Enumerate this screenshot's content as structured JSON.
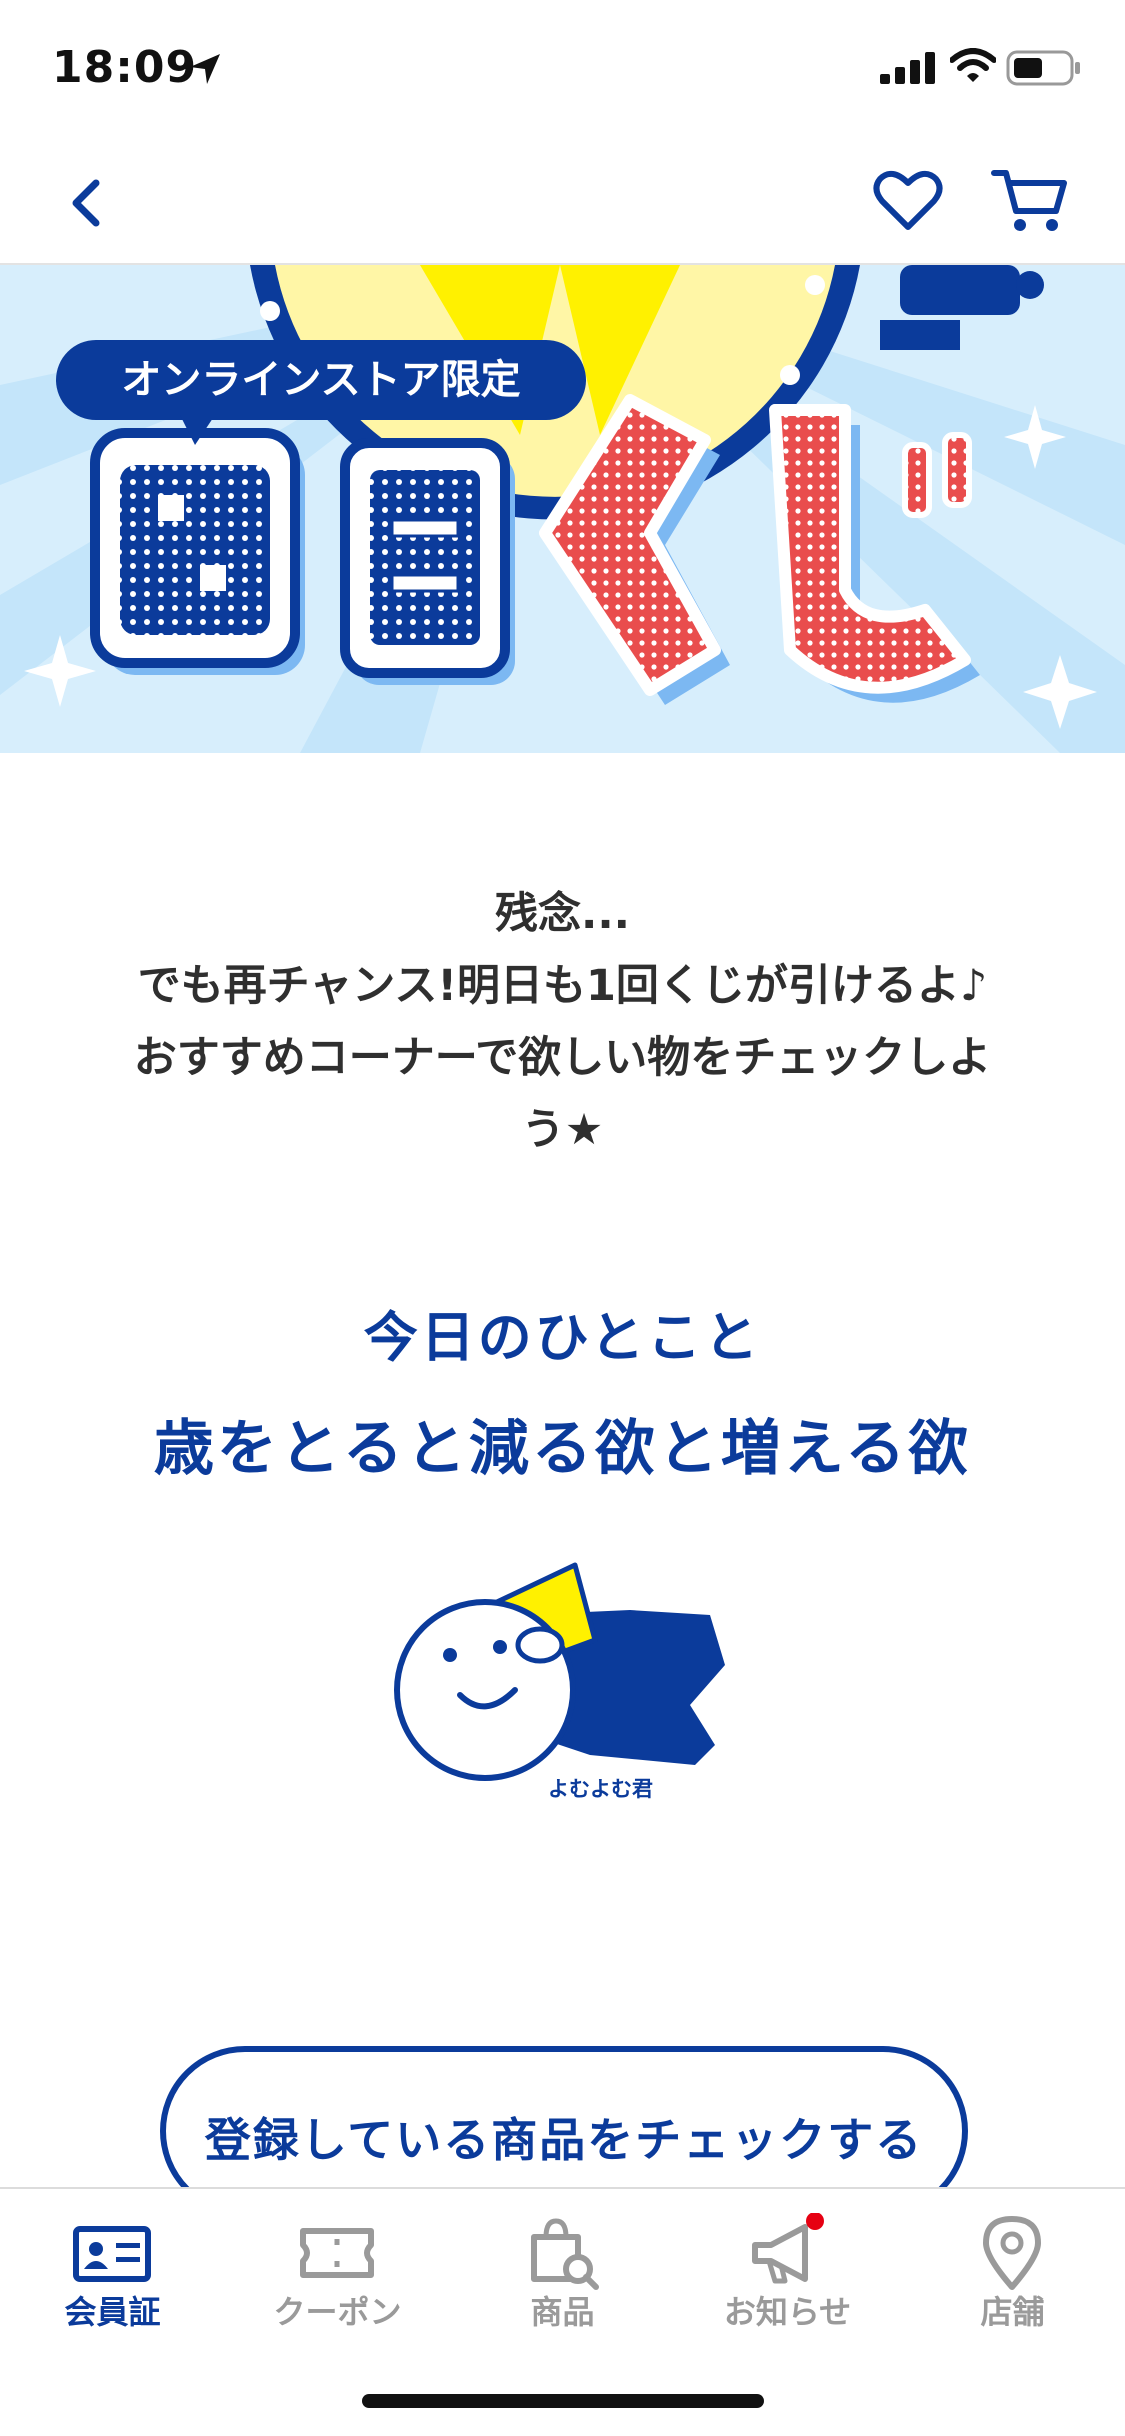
{
  "status_bar": {
    "time": "18:09"
  },
  "banner": {
    "badge": "オンラインストア限定",
    "title": "毎日くじ"
  },
  "message": {
    "line1": "残念...",
    "line2": "でも再チャンス!明日も1回くじが引けるよ♪",
    "line3": "おすすめコーナーで欲しい物をチェックしよ",
    "line4": "う★"
  },
  "today": {
    "heading": "今日のひとこと",
    "phrase": "歳をとると減る欲と増える欲"
  },
  "mascot": {
    "name": "よむよむ君"
  },
  "check_button": {
    "label": "登録している商品をチェックする"
  },
  "tabs": [
    {
      "label": "会員証",
      "icon": "member-card-icon",
      "active": true
    },
    {
      "label": "クーポン",
      "icon": "coupon-ticket-icon"
    },
    {
      "label": "商品",
      "icon": "shopping-bag-search-icon"
    },
    {
      "label": "お知らせ",
      "icon": "megaphone-icon",
      "badge": true
    },
    {
      "label": "店舗",
      "icon": "map-pin-icon"
    }
  ],
  "colors": {
    "brand": "#0b3b9b",
    "accent_red": "#e94d4d",
    "banner_bg": "#d7eefc",
    "badge_dot": "#e60012",
    "inactive": "#9a9a9a"
  }
}
